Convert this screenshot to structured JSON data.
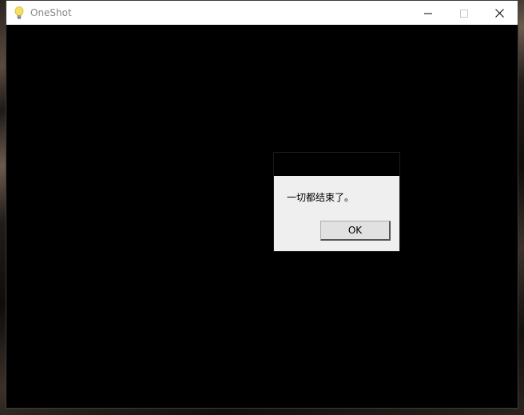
{
  "window": {
    "title": "OneShot",
    "app_icon": "lightbulb-icon",
    "controls": {
      "minimize_icon": "minimize-icon",
      "maximize_icon": "maximize-icon",
      "close_icon": "close-icon"
    }
  },
  "dialog": {
    "message": "一切都结束了。",
    "ok_label": "OK"
  },
  "colors": {
    "titlebar": "#ffffff",
    "client_background": "#000000",
    "dialog_background": "#efefef",
    "lightbulb": "#f6e05e"
  }
}
